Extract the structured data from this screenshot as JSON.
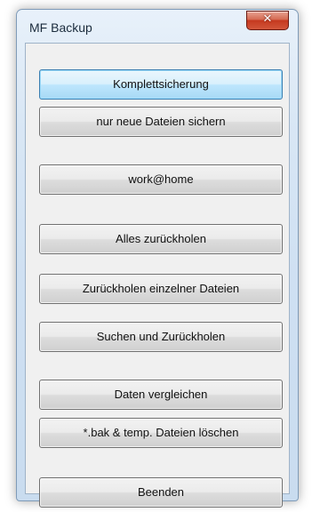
{
  "window": {
    "title": "MF Backup",
    "close_glyph": "✕"
  },
  "buttons": [
    {
      "label": "Komplettsicherung",
      "default": true
    },
    {
      "label": "nur neue Dateien sichern"
    },
    {
      "label": "work@home"
    },
    {
      "label": "Alles zurückholen"
    },
    {
      "label": "Zurückholen einzelner Dateien"
    },
    {
      "label": "Suchen und Zurückholen"
    },
    {
      "label": "Daten vergleichen"
    },
    {
      "label": "*.bak & temp. Dateien löschen"
    },
    {
      "label": "Beenden"
    }
  ],
  "colors": {
    "frame": "#cfe0f2",
    "client": "#f0f0f0",
    "close": "#c5391f",
    "default_button": "#bee6fd"
  }
}
